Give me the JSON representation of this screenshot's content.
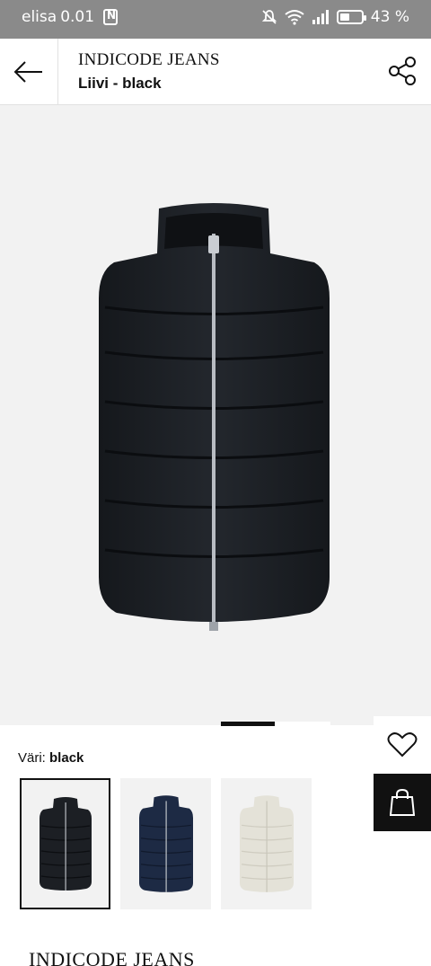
{
  "status_bar": {
    "carrier": "elisa",
    "data_rate": "0.01",
    "battery": "43 %"
  },
  "header": {
    "brand": "INDICODE JEANS",
    "product": "Liivi - black"
  },
  "colour": {
    "label": "Väri:",
    "value": "black",
    "swatches": [
      {
        "name": "black",
        "color": "#1c1f24",
        "selected": true
      },
      {
        "name": "navy",
        "color": "#1d2a44",
        "selected": false
      },
      {
        "name": "cream",
        "color": "#e4e2d8",
        "selected": false
      }
    ]
  },
  "footer": {
    "brand": "INDICODE JEANS"
  },
  "colors": {
    "statusbar": "#8a8a8a",
    "image_bg": "#f2f2f2",
    "accent": "#111111"
  },
  "icons": [
    "back-arrow-icon",
    "share-icon",
    "heart-icon",
    "shopping-bag-icon"
  ]
}
